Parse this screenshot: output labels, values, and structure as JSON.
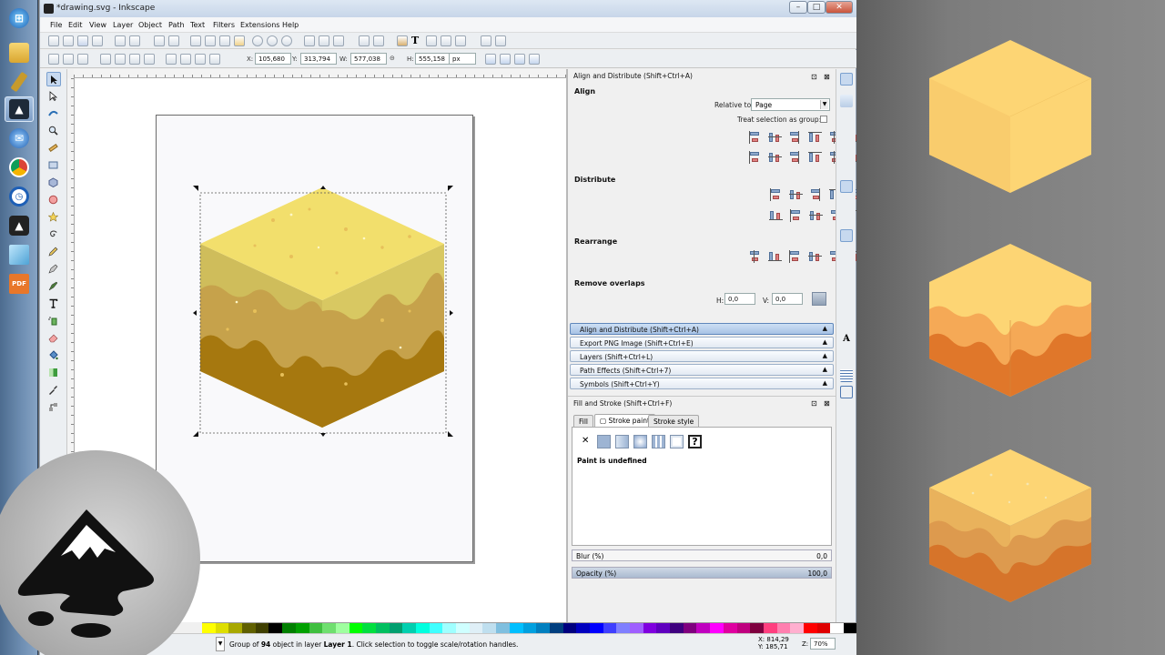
{
  "taskbar": {
    "items": [
      "start-orb",
      "explorer",
      "pen-app",
      "inkscape",
      "thunderbird",
      "chrome",
      "clock",
      "inkscape-alt",
      "sketch",
      "pdf"
    ]
  },
  "window": {
    "title": "*drawing.svg - Inkscape",
    "controls": {
      "minimize": "–",
      "maximize": "□",
      "close": "✕"
    }
  },
  "menubar": {
    "items": [
      "File",
      "Edit",
      "View",
      "Layer",
      "Object",
      "Path",
      "Text",
      "Filters",
      "Extensions",
      "Help"
    ]
  },
  "controls": {
    "x_label": "X:",
    "x_value": "105,680",
    "y_label": "Y:",
    "y_value": "313,794",
    "w_label": "W:",
    "w_value": "577,038",
    "h_label": "H:",
    "h_value": "555,158",
    "unit": "px"
  },
  "align_dialog": {
    "title": "Align and Distribute (Shift+Ctrl+A)",
    "align_heading": "Align",
    "relative_to_label": "Relative to:",
    "relative_to_value": "Page",
    "treat_as_group_label": "Treat selection as group:",
    "distribute_heading": "Distribute",
    "rearrange_heading": "Rearrange",
    "remove_overlaps_heading": "Remove overlaps",
    "h_label": "H:",
    "h_value": "0,0",
    "v_label": "V:",
    "v_value": "0,0"
  },
  "collapsed_dialogs": [
    "Align and Distribute (Shift+Ctrl+A)",
    "Export PNG Image (Shift+Ctrl+E)",
    "Layers (Shift+Ctrl+L)",
    "Path Effects  (Shift+Ctrl+7)",
    "Symbols (Shift+Ctrl+Y)"
  ],
  "fill_stroke": {
    "title": "Fill and Stroke (Shift+Ctrl+F)",
    "tabs": [
      "Fill",
      "Stroke paint",
      "Stroke style"
    ],
    "active_tab": "Stroke paint",
    "paint_buttons": [
      "✕",
      "",
      "",
      "",
      "",
      "",
      "?"
    ],
    "paint_status": "Paint is undefined",
    "blur_label": "Blur (%)",
    "blur_value": "0,0",
    "opacity_label": "Opacity (%)",
    "opacity_value": "100,0"
  },
  "status": {
    "message_prefix": "Group of ",
    "count": "94",
    "message_mid": " object in layer ",
    "layer": "Layer 1",
    "message_suffix": ". Click selection to toggle scale/rotation handles.",
    "x_coord_label": "X:",
    "x_coord": "814,29",
    "y_coord_label": "Y:",
    "y_coord": "185,71",
    "zoom_label": "Z:",
    "zoom": "70%"
  },
  "colors": {
    "cube_top": "#f2df6c",
    "cube_left": "#cfbd5b",
    "cube_right": "#d8c862",
    "band_mid": "#c6a24b",
    "band_low": "#a6780f",
    "preview_top": "#fdd574",
    "preview_orange": "#f5a956",
    "preview_deep": "#e0772a"
  }
}
